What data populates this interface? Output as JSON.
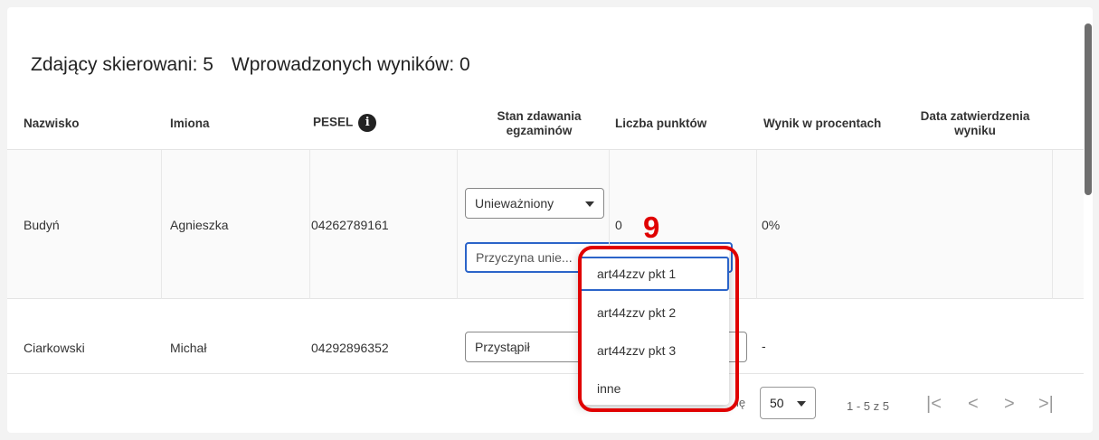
{
  "summary": {
    "assigned": "Zdający skierowani: 5",
    "entered": "Wprowadzonych wyników: 0"
  },
  "table": {
    "headers": {
      "surname": "Nazwisko",
      "names": "Imiona",
      "pesel": "PESEL",
      "exam_status": [
        "Stan zdawania",
        "egzaminów"
      ],
      "points": "Liczba punktów",
      "percent": "Wynik w procentach",
      "approval_date": [
        "Data zatwierdzenia",
        "wyniku"
      ]
    },
    "pesel_info_icon": "info-icon",
    "rows": [
      {
        "surname": "Budyń",
        "names": "Agnieszka",
        "pesel": "04262789161",
        "status_value": "Unieważniony",
        "reason_placeholder": "Przyczyna unie...",
        "points": "0",
        "percent": "0%",
        "approval_date": ""
      },
      {
        "surname": "Ciarkowski",
        "names": "Michał",
        "pesel": "04292896352",
        "status_value": "Przystąpił",
        "points": "",
        "percent": "-",
        "approval_date": ""
      }
    ]
  },
  "dropdown": {
    "options": [
      "art44zzv pkt 1",
      "art44zzv pkt 2",
      "art44zzv pkt 3",
      "inne"
    ],
    "highlighted_index": 0
  },
  "footer": {
    "rows_per_page_suffix": "ię",
    "rows_per_page": "50",
    "range": "1 - 5 z 5",
    "nav": {
      "first": "|<",
      "prev": "<",
      "next": ">",
      "last": ">|"
    }
  },
  "annotation": {
    "number": "9",
    "color": "#e00000"
  },
  "colors": {
    "focus_border": "#2b64c9"
  }
}
